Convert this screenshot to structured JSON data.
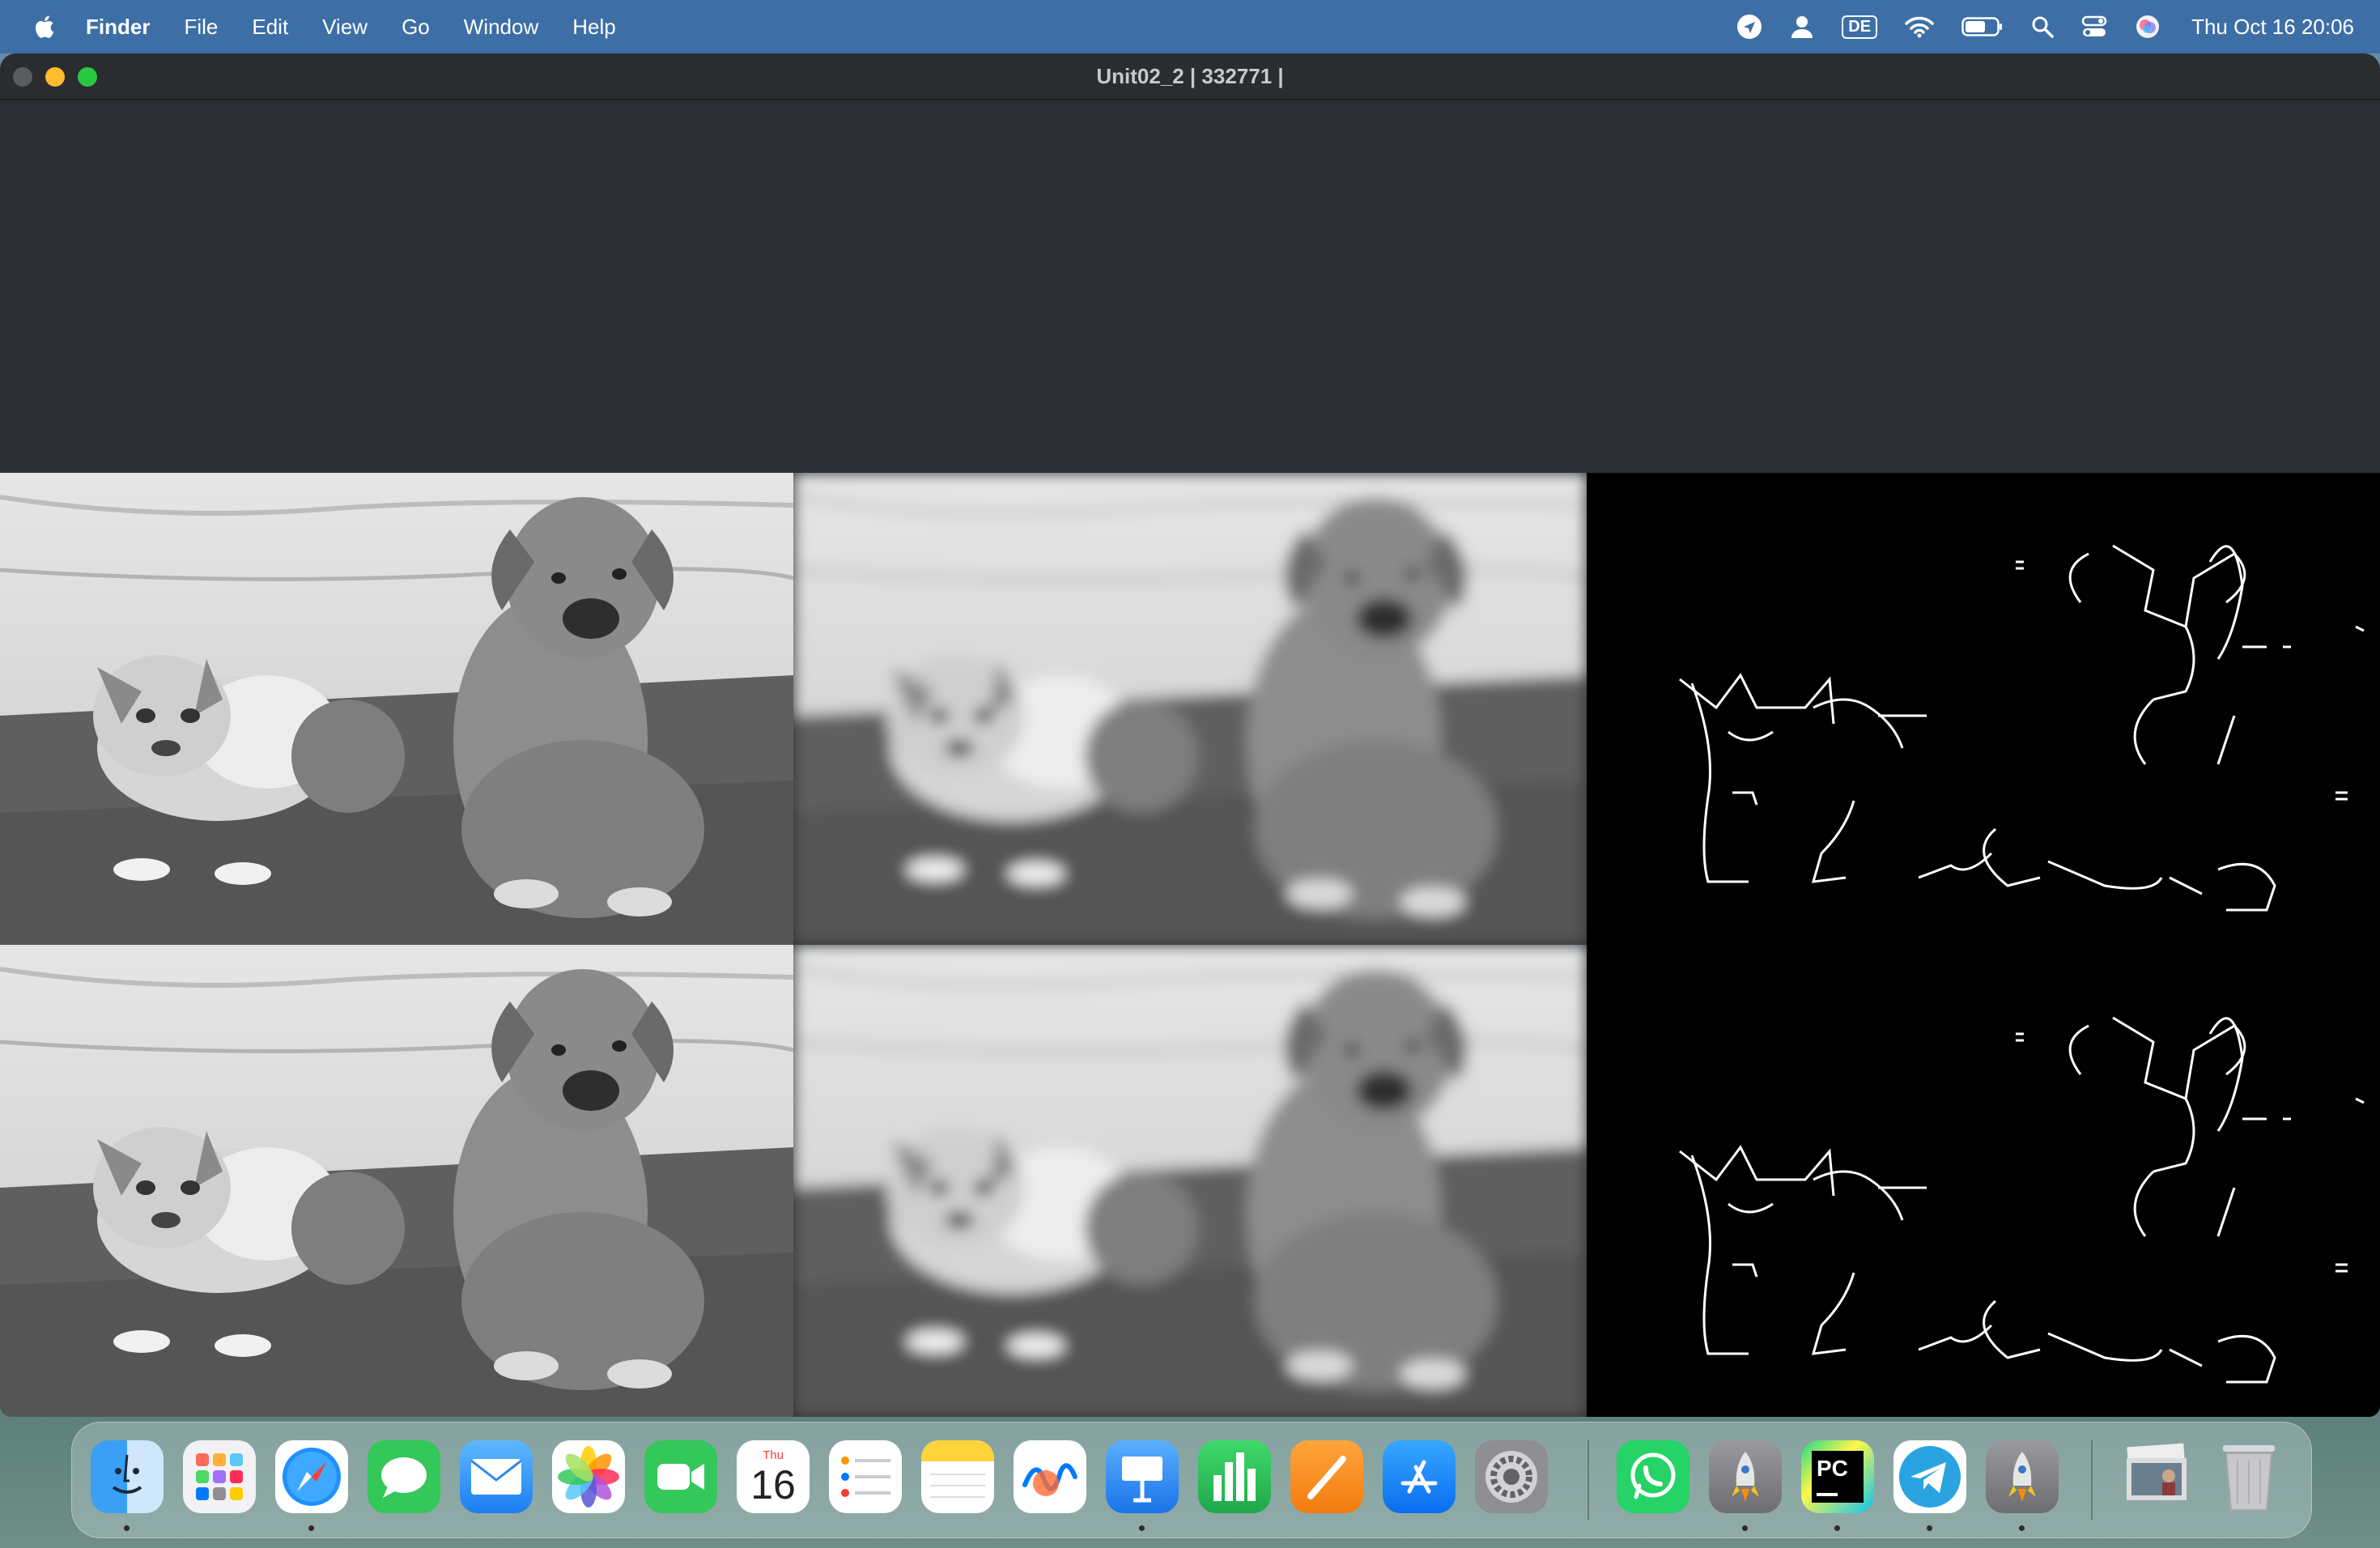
{
  "menubar": {
    "app_name": "Finder",
    "menus": [
      "File",
      "Edit",
      "View",
      "Go",
      "Window",
      "Help"
    ],
    "input_source": "DE",
    "clock": "Thu Oct 16  20:06",
    "icons": [
      "location-arrow-icon",
      "user-icon",
      "input-source-icon",
      "wifi-icon",
      "battery-icon",
      "spotlight-search-icon",
      "control-center-icon",
      "siri-icon"
    ]
  },
  "window": {
    "title": "Unit02_2 | 332771 |",
    "panels": [
      {
        "row": 1,
        "col": 1,
        "kind": "grayscale"
      },
      {
        "row": 1,
        "col": 2,
        "kind": "blurred"
      },
      {
        "row": 1,
        "col": 3,
        "kind": "edges"
      },
      {
        "row": 2,
        "col": 1,
        "kind": "grayscale"
      },
      {
        "row": 2,
        "col": 2,
        "kind": "blurred"
      },
      {
        "row": 2,
        "col": 3,
        "kind": "edges"
      }
    ]
  },
  "dock": {
    "apps": [
      {
        "name": "Finder",
        "icon": "finder-icon",
        "running": true
      },
      {
        "name": "Launchpad",
        "icon": "launchpad-icon",
        "running": false
      },
      {
        "name": "Safari",
        "icon": "safari-icon",
        "running": true
      },
      {
        "name": "Messages",
        "icon": "messages-icon",
        "running": false
      },
      {
        "name": "Mail",
        "icon": "mail-icon",
        "running": false
      },
      {
        "name": "Photos",
        "icon": "photos-icon",
        "running": false
      },
      {
        "name": "FaceTime",
        "icon": "facetime-icon",
        "running": false
      },
      {
        "name": "Calendar",
        "icon": "calendar-icon",
        "running": false,
        "day_label": "Thu",
        "date": "16"
      },
      {
        "name": "Reminders",
        "icon": "reminders-icon",
        "running": false
      },
      {
        "name": "Notes",
        "icon": "notes-icon",
        "running": false
      },
      {
        "name": "Freeform",
        "icon": "freeform-icon",
        "running": false
      },
      {
        "name": "Keynote",
        "icon": "keynote-icon",
        "running": true
      },
      {
        "name": "Numbers",
        "icon": "numbers-icon",
        "running": false
      },
      {
        "name": "Pages",
        "icon": "pages-icon",
        "running": false
      },
      {
        "name": "App Store",
        "icon": "app-store-icon",
        "running": false
      },
      {
        "name": "System Settings",
        "icon": "system-settings-icon",
        "running": false
      },
      {
        "name": "WhatsApp",
        "icon": "whatsapp-icon",
        "running": false
      },
      {
        "name": "Python Launcher",
        "icon": "python-rocket-icon",
        "running": true
      },
      {
        "name": "PyCharm",
        "icon": "pycharm-icon",
        "running": true
      },
      {
        "name": "Telegram",
        "icon": "telegram-icon",
        "running": true
      },
      {
        "name": "Python",
        "icon": "python-rocket-icon",
        "running": true
      },
      {
        "name": "Downloads",
        "icon": "downloads-stack-icon",
        "running": false
      },
      {
        "name": "Trash",
        "icon": "trash-icon",
        "running": false
      }
    ]
  },
  "colors": {
    "menubar": "#3d6fa6",
    "window_bg": "#2c3034",
    "titlebar": "#2a2d30"
  }
}
